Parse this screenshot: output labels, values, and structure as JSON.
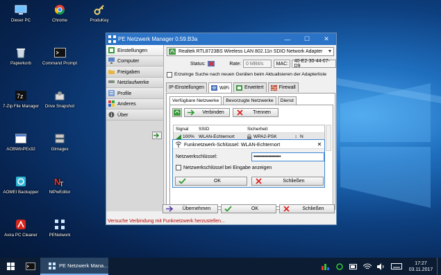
{
  "desktop": {
    "icons": [
      {
        "label": "Dieser PC",
        "icon": "computer-icon"
      },
      {
        "label": "Chrome",
        "icon": "chrome-icon"
      },
      {
        "label": "ProduKey",
        "icon": "key-icon"
      },
      {
        "label": "Papierkorb",
        "icon": "recycle-bin-icon"
      },
      {
        "label": "Command Prompt",
        "icon": "terminal-icon"
      },
      {
        "label": "7-Zip File Manager",
        "icon": "7zip-icon"
      },
      {
        "label": "Drive Snapshot",
        "icon": "snapshot-icon"
      },
      {
        "label": "ACBWinPEx32",
        "icon": "app-window-icon"
      },
      {
        "label": "GImagex",
        "icon": "imagex-icon"
      },
      {
        "label": "AOMEI Backupper",
        "icon": "backup-icon"
      },
      {
        "label": "NtPwEditor",
        "icon": "password-editor-icon"
      },
      {
        "label": "Avira PC Cleaner",
        "icon": "avira-icon"
      },
      {
        "label": "PENetwork",
        "icon": "network-icon"
      }
    ]
  },
  "window": {
    "title": "PE Netzwerk Manager 0.59.B3a",
    "sidebar": [
      {
        "label": "Einstellungen",
        "icon": "settings-icon"
      },
      {
        "label": "Computer",
        "icon": "computer-icon"
      },
      {
        "label": "Freigaben",
        "icon": "folder-icon"
      },
      {
        "label": "Netzlaufwerke",
        "icon": "network-drive-icon"
      },
      {
        "label": "Profile",
        "icon": "profile-icon"
      },
      {
        "label": "Anderes",
        "icon": "grid-icon"
      },
      {
        "label": "Über",
        "icon": "info-icon"
      }
    ],
    "adapter": "Realtek RTL8723BS Wireless LAN 802.11n SDIO Network Adapter",
    "status_label": "Status:",
    "rate_label": "Rate:",
    "rate_value": "0 MBit/s",
    "mac_label": "MAC:",
    "mac_value": "40-E2-30-44-07-D9",
    "force_search_label": "Erzwinge Suche nach neuen Geräten beim Aktualisieren der Adapterliste",
    "tabs": [
      "IP-Einstellungen",
      "WiFi",
      "Erweitert",
      "Firewall"
    ],
    "subtabs": [
      "Verfügbare Netzwerke",
      "Bevorzugte Netzwerke",
      "Dienst"
    ],
    "connect_label": "Verbinden",
    "disconnect_label": "Trennen",
    "table_headers": {
      "signal": "Signal",
      "ssid": "SSID",
      "security": "Sicherheit"
    },
    "network_row": {
      "signal": "100%",
      "ssid": "WLAN-Echternort",
      "security": "WPA2-PSK",
      "flag": "N"
    },
    "bottom_buttons": {
      "apply": "Übernehmen",
      "ok": "OK",
      "close": "Schließen"
    },
    "status_message": "Versuche Verbindung mit Funknetzwerk herzustellen..."
  },
  "dialog": {
    "title": "Funknetzwerk-Schlüssel: WLAN-Echternort",
    "key_label": "Netzwerkschlüssel:",
    "key_value": "••••••••••••••••••••",
    "show_key_label": "Netzwerkschlüssel bei Eingabe anzeigen",
    "ok_label": "OK",
    "close_label": "Schließen"
  },
  "taskbar": {
    "task_label": "PE Netzwerk Mana...",
    "time": "17:27",
    "date": "03.11.2017"
  }
}
